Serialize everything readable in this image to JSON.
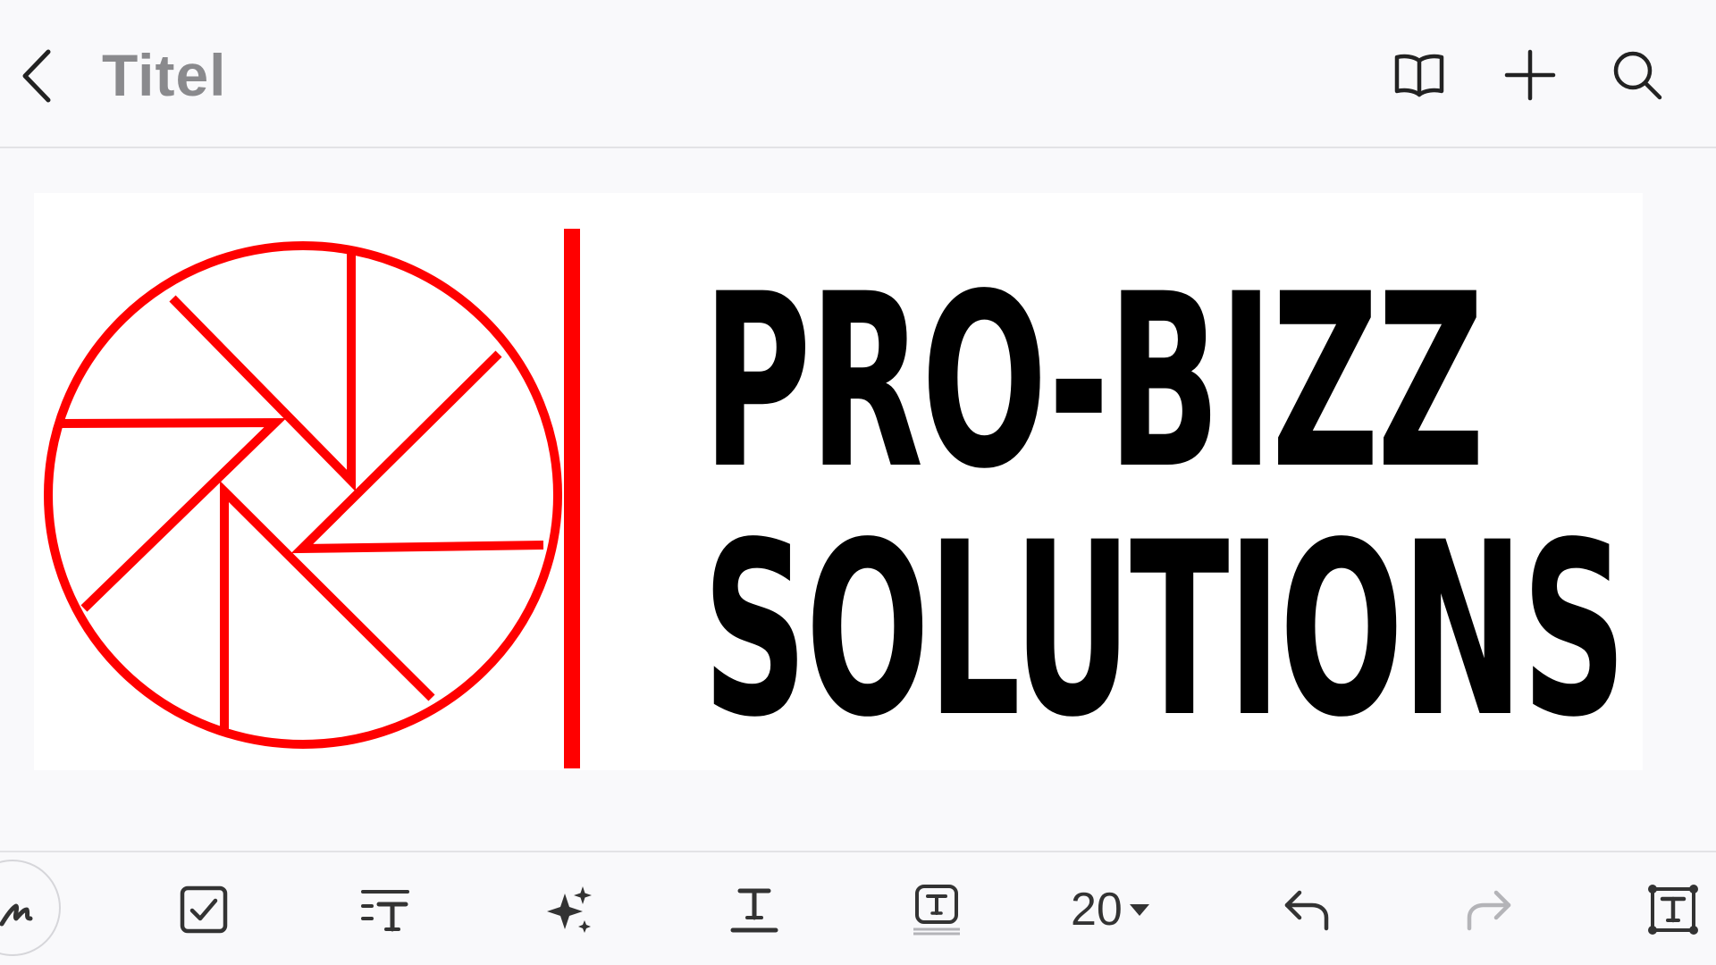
{
  "header": {
    "title": "Titel",
    "back_icon": "chevron-left-icon",
    "actions": [
      {
        "name": "book-icon"
      },
      {
        "name": "plus-icon"
      },
      {
        "name": "search-icon"
      }
    ]
  },
  "document": {
    "logo": {
      "line1": "PRO-BIZZ",
      "line2": "SOLUTIONS",
      "emblem": "camera-shutter-icon",
      "emblem_color": "#ff0000",
      "text_color": "#000000"
    }
  },
  "toolbar": {
    "tools": [
      {
        "name": "pen-icon"
      },
      {
        "name": "checkbox-icon"
      },
      {
        "name": "text-style-icon"
      },
      {
        "name": "sparkles-icon"
      },
      {
        "name": "underline-text-icon"
      },
      {
        "name": "text-box-icon"
      }
    ],
    "font_size": "20",
    "undo_icon": "undo-icon",
    "redo_icon": "redo-icon",
    "text_frame_icon": "text-frame-icon"
  },
  "colors": {
    "background": "#f9f9fb",
    "title_gray": "#8a8a8d",
    "icon_dark": "#222222",
    "icon_disabled": "#b4b4b8",
    "accent_red": "#ff0000"
  }
}
